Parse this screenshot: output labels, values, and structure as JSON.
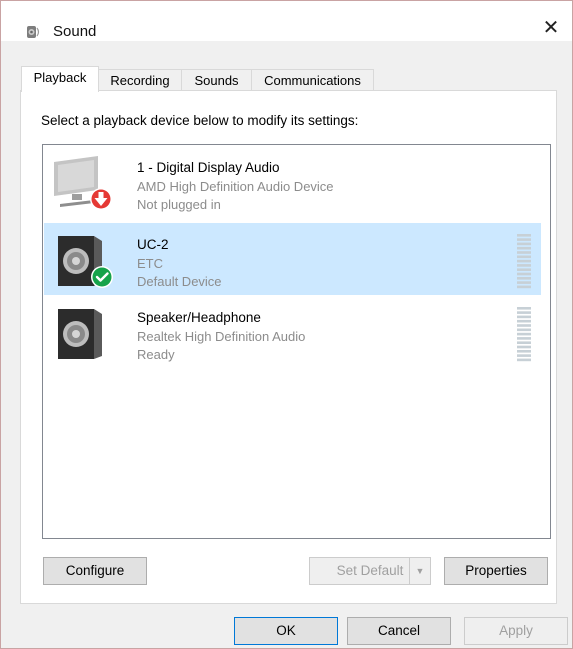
{
  "window": {
    "title": "Sound",
    "close_glyph": "✕"
  },
  "tabs": [
    {
      "label": "Playback",
      "active": true
    },
    {
      "label": "Recording",
      "active": false
    },
    {
      "label": "Sounds",
      "active": false
    },
    {
      "label": "Communications",
      "active": false
    }
  ],
  "playback": {
    "instruction": "Select a playback device below to modify its settings:",
    "devices": [
      {
        "name": "1 - Digital Display Audio",
        "description": "AMD High Definition Audio Device",
        "status": "Not plugged in",
        "icon": "monitor-icon",
        "badge": "red-down-arrow-icon",
        "selected": false
      },
      {
        "name": "UC-2",
        "description": "ETC",
        "status": "Default Device",
        "icon": "speaker-icon",
        "badge": "green-check-icon",
        "selected": true
      },
      {
        "name": "Speaker/Headphone",
        "description": "Realtek High Definition Audio",
        "status": "Ready",
        "icon": "speaker-icon",
        "badge": "",
        "selected": false
      }
    ],
    "buttons": {
      "configure": "Configure",
      "set_default": "Set Default",
      "properties": "Properties"
    }
  },
  "footer": {
    "ok": "OK",
    "cancel": "Cancel",
    "apply": "Apply"
  },
  "colors": {
    "selection": "#cce8ff",
    "accent": "#0078d7",
    "check": "#16a34a",
    "arrow": "#d32f2f"
  }
}
